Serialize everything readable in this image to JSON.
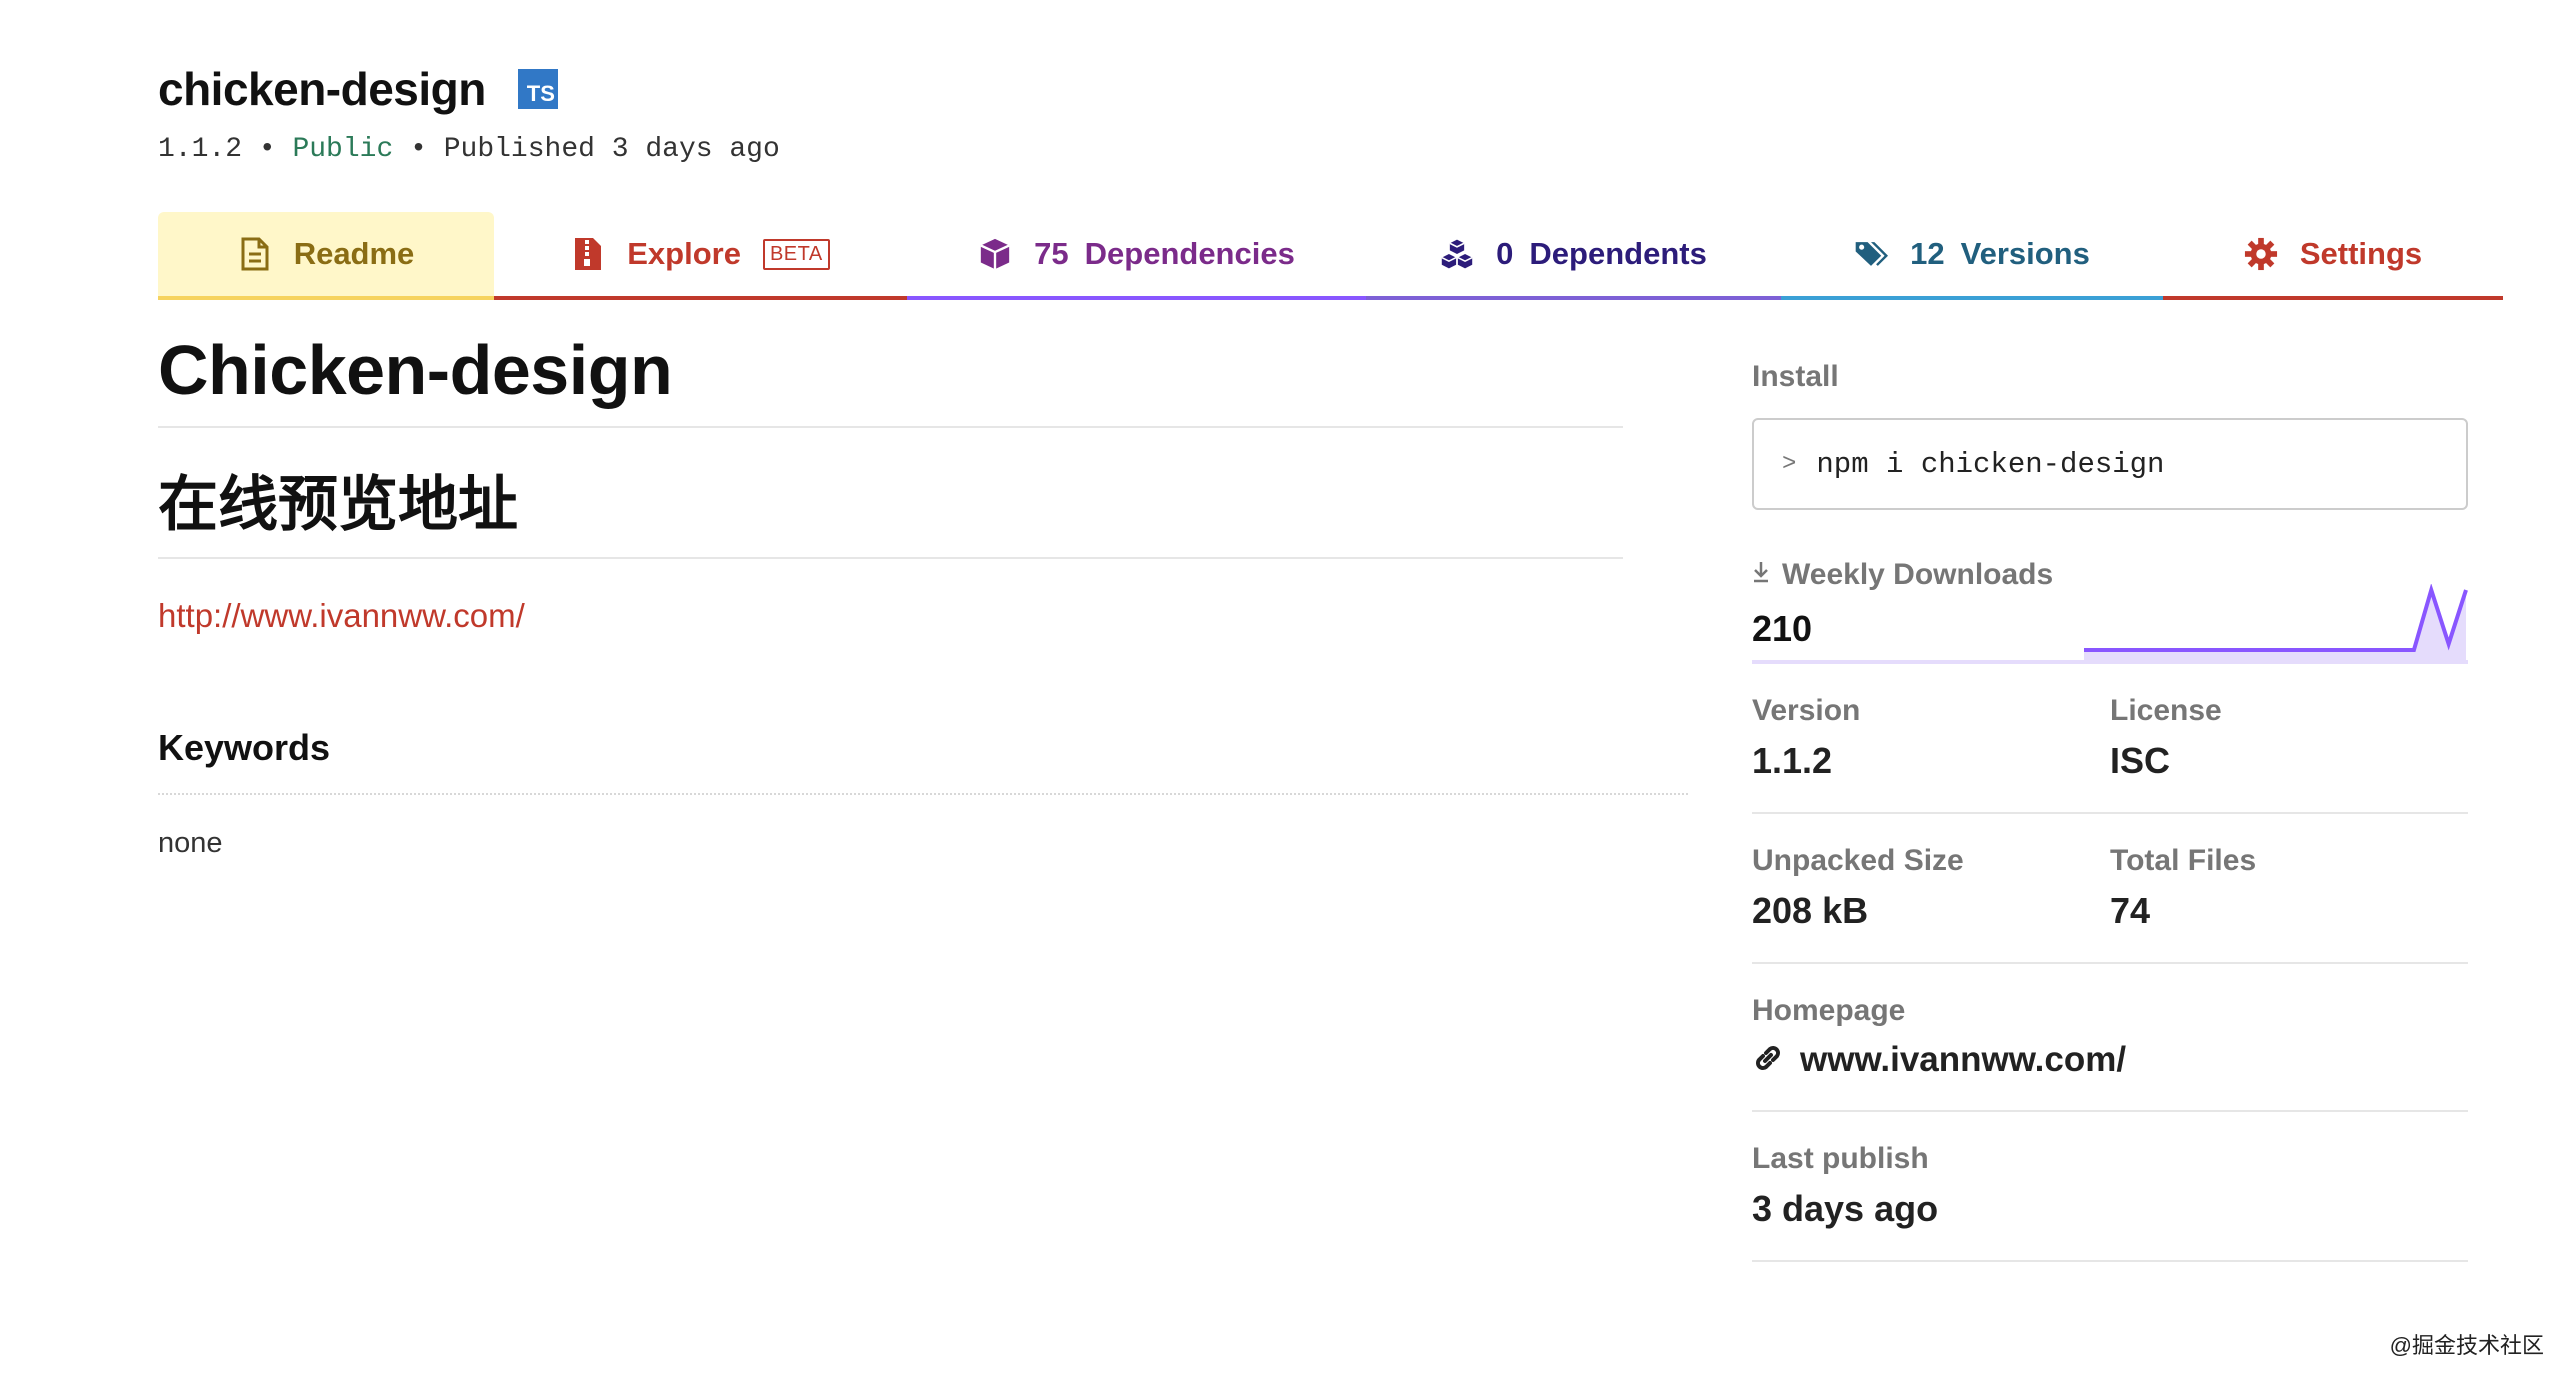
{
  "package": {
    "name": "chicken-design",
    "ts_badge": "TS",
    "version": "1.1.2",
    "sep": "•",
    "visibility": "Public",
    "published": "Published 3 days ago"
  },
  "tabs": [
    {
      "label": "Readme",
      "icon": "file-text-icon"
    },
    {
      "label": "Explore",
      "badge": "BETA",
      "icon": "file-zip-icon"
    },
    {
      "count": "75",
      "label": "Dependencies",
      "icon": "box-icon"
    },
    {
      "count": "0",
      "label": "Dependents",
      "icon": "boxes-icon"
    },
    {
      "count": "12",
      "label": "Versions",
      "icon": "tags-icon"
    },
    {
      "label": "Settings",
      "icon": "gear-icon"
    }
  ],
  "readme": {
    "title": "Chicken-design",
    "subtitle": "在线预览地址",
    "link": "http://www.ivannww.com/",
    "keywords_title": "Keywords",
    "keywords_value": "none"
  },
  "sidebar": {
    "install_label": "Install",
    "install_cmd": "npm i chicken-design",
    "weekly_downloads_label": "Weekly Downloads",
    "weekly_downloads": "210",
    "weekly_downloads_series": [
      0,
      0,
      0,
      0,
      0,
      0,
      0,
      0,
      0,
      0,
      0,
      0,
      0,
      0,
      0,
      0,
      0,
      0,
      0,
      0,
      1,
      0.1,
      1
    ],
    "version_label": "Version",
    "version_value": "1.1.2",
    "license_label": "License",
    "license_value": "ISC",
    "unpacked_label": "Unpacked Size",
    "unpacked_value": "208 kB",
    "files_label": "Total Files",
    "files_value": "74",
    "homepage_label": "Homepage",
    "homepage_value": "www.ivannww.com/",
    "last_publish_label": "Last publish",
    "last_publish_value": "3 days ago"
  },
  "colors": {
    "spark_line": "#8956ff",
    "spark_fill": "#e5dcfc"
  },
  "watermark": "@掘金技术社区"
}
